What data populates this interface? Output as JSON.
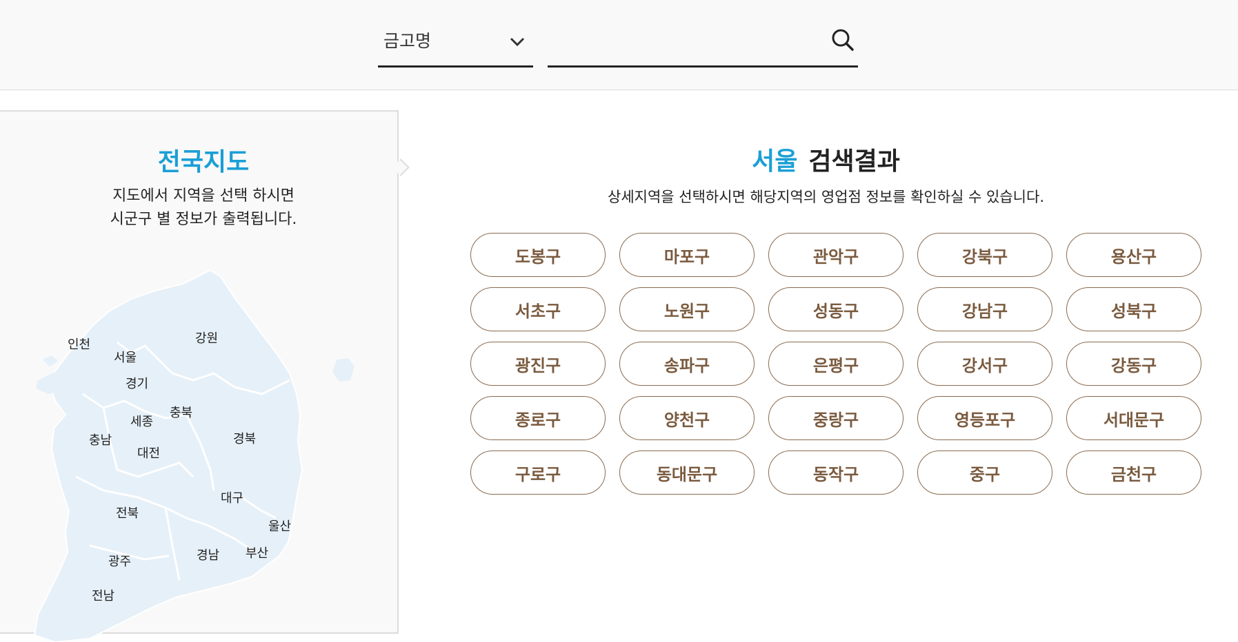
{
  "search": {
    "category_selected": "금고명",
    "input_value": "",
    "input_placeholder": ""
  },
  "map_panel": {
    "title": "전국지도",
    "desc_line1": "지도에서 지역을 선택 하시면",
    "desc_line2": "시군구 별 정보가 출력됩니다.",
    "regions": [
      "인천",
      "강원",
      "서울",
      "경기",
      "충북",
      "세종",
      "충남",
      "경북",
      "대전",
      "대구",
      "전북",
      "울산",
      "광주",
      "경남",
      "부산",
      "전남"
    ]
  },
  "results": {
    "region": "서울",
    "title_suffix": "검색결과",
    "desc": "상세지역을 선택하시면 해당지역의 영업점 정보를 확인하실 수 있습니다.",
    "districts": [
      "도봉구",
      "마포구",
      "관악구",
      "강북구",
      "용산구",
      "서초구",
      "노원구",
      "성동구",
      "강남구",
      "성북구",
      "광진구",
      "송파구",
      "은평구",
      "강서구",
      "강동구",
      "종로구",
      "양천구",
      "중랑구",
      "영등포구",
      "서대문구",
      "구로구",
      "동대문구",
      "동작구",
      "중구",
      "금천구"
    ]
  },
  "colors": {
    "accent": "#1a9fd6",
    "button_border": "#8a6a4e",
    "button_text": "#7a5a3e",
    "map_fill": "#e6f0f8"
  }
}
